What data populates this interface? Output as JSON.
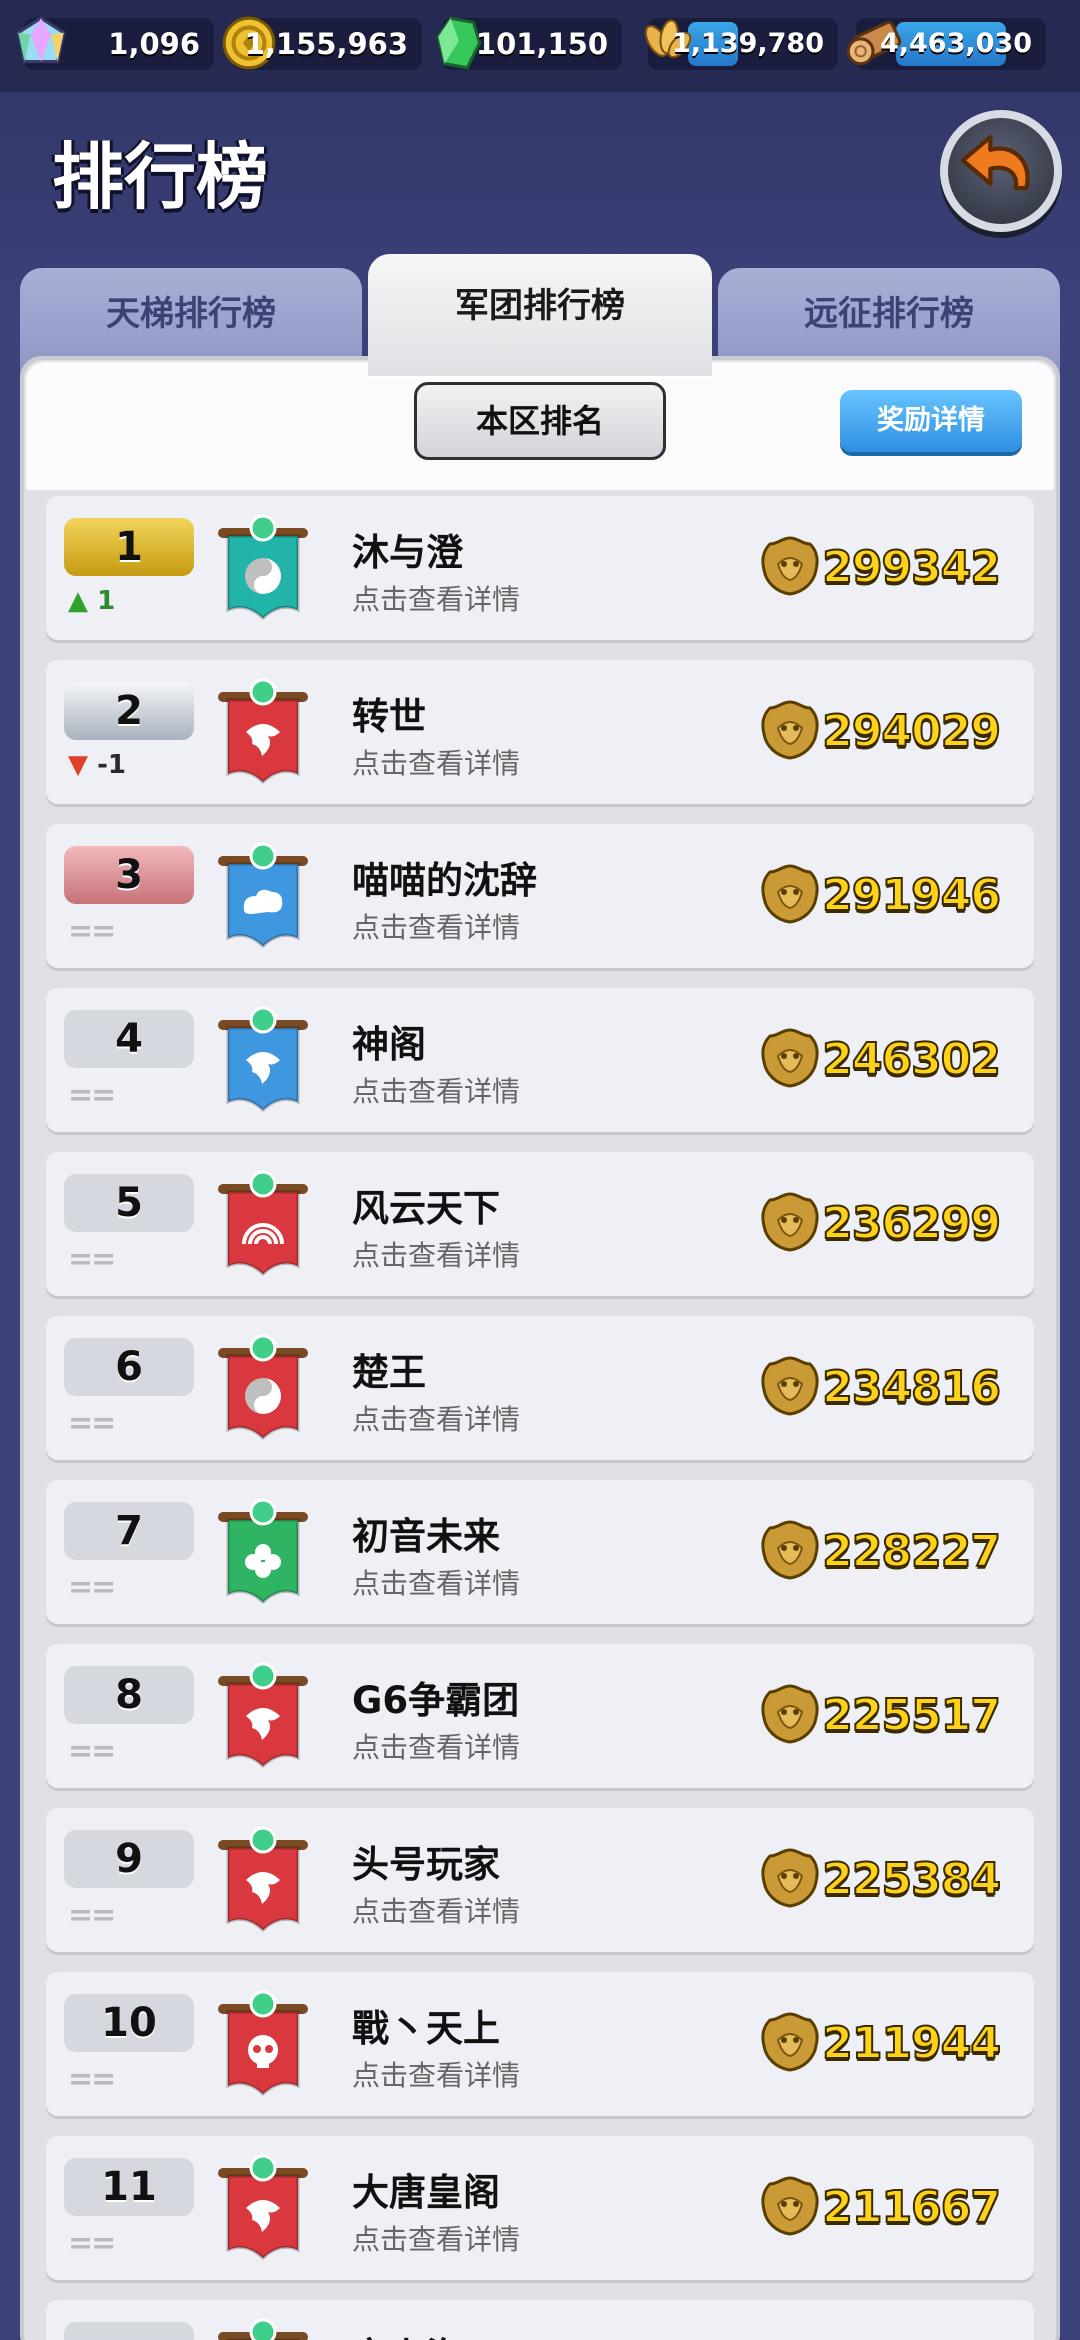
{
  "resources": [
    {
      "name": "gem-icon",
      "value": "1,096"
    },
    {
      "name": "gold-coin-icon",
      "value": "1,155,963"
    },
    {
      "name": "green-crystal-icon",
      "value": "101,150"
    },
    {
      "name": "wheat-icon",
      "value": "1,139,780"
    },
    {
      "name": "wood-icon",
      "value": "4,463,030"
    }
  ],
  "page": {
    "title": "排行榜"
  },
  "tabs": [
    {
      "label": "天梯排行榜",
      "active": false
    },
    {
      "label": "军团排行榜",
      "active": true
    },
    {
      "label": "远征排行榜",
      "active": false
    }
  ],
  "controls": {
    "region_label": "本区排名",
    "reward_label": "奖励详情"
  },
  "rows": [
    {
      "rank": "1",
      "change": "1",
      "dir": "up",
      "name": "沐与澄",
      "sub": "点击查看详情",
      "score": "299342",
      "banner": "teal",
      "emblem": "yin-yang"
    },
    {
      "rank": "2",
      "change": "-1",
      "dir": "down",
      "name": "转世",
      "sub": "点击查看详情",
      "score": "294029",
      "banner": "red",
      "emblem": "dragon"
    },
    {
      "rank": "3",
      "change": "",
      "dir": "same",
      "name": "喵喵的沈辞",
      "sub": "点击查看详情",
      "score": "291946",
      "banner": "blue",
      "emblem": "cloud"
    },
    {
      "rank": "4",
      "change": "",
      "dir": "same",
      "name": "神阁",
      "sub": "点击查看详情",
      "score": "246302",
      "banner": "blue",
      "emblem": "dragon"
    },
    {
      "rank": "5",
      "change": "",
      "dir": "same",
      "name": "风云天下",
      "sub": "点击查看详情",
      "score": "236299",
      "banner": "red",
      "emblem": "wave"
    },
    {
      "rank": "6",
      "change": "",
      "dir": "same",
      "name": "楚王",
      "sub": "点击查看详情",
      "score": "234816",
      "banner": "red",
      "emblem": "yin-yang"
    },
    {
      "rank": "7",
      "change": "",
      "dir": "same",
      "name": "初音未来",
      "sub": "点击查看详情",
      "score": "228227",
      "banner": "green",
      "emblem": "clover"
    },
    {
      "rank": "8",
      "change": "",
      "dir": "same",
      "name": "G6争霸团",
      "sub": "点击查看详情",
      "score": "225517",
      "banner": "red",
      "emblem": "dragon"
    },
    {
      "rank": "9",
      "change": "",
      "dir": "same",
      "name": "头号玩家",
      "sub": "点击查看详情",
      "score": "225384",
      "banner": "red",
      "emblem": "dragon"
    },
    {
      "rank": "10",
      "change": "",
      "dir": "same",
      "name": "戰丶天上",
      "sub": "点击查看详情",
      "score": "211944",
      "banner": "red",
      "emblem": "skull"
    },
    {
      "rank": "11",
      "change": "",
      "dir": "same",
      "name": "大唐皇阁",
      "sub": "点击查看详情",
      "score": "211667",
      "banner": "red",
      "emblem": "dragon"
    },
    {
      "rank": "",
      "change": "",
      "dir": "same",
      "name": "京上海",
      "sub": "",
      "score": "",
      "banner": "green",
      "emblem": "clover"
    }
  ],
  "colors": {
    "teal": "#22b3a9",
    "red": "#d8383e",
    "blue": "#3f97e0",
    "green": "#2fb463",
    "accent": "#ffd21a"
  }
}
